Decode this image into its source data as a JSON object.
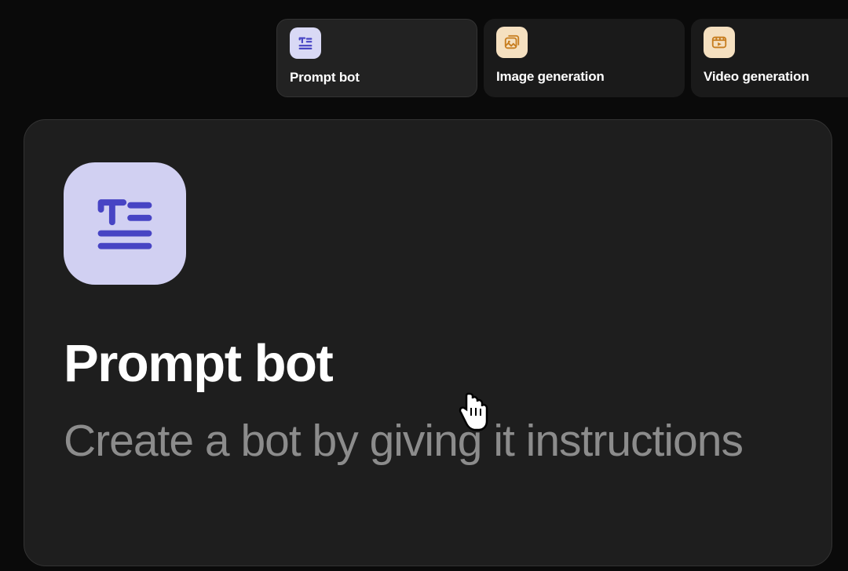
{
  "tabs": [
    {
      "label": "Prompt bot",
      "icon": "text-lines-icon",
      "iconTheme": "purple"
    },
    {
      "label": "Image generation",
      "icon": "image-stack-icon",
      "iconTheme": "orange"
    },
    {
      "label": "Video generation",
      "icon": "video-icon",
      "iconTheme": "orange"
    }
  ],
  "card": {
    "title": "Prompt bot",
    "description": "Create a bot by giving it instructions",
    "icon": "text-lines-icon",
    "iconTheme": "purple"
  },
  "colors": {
    "purpleBg": "#d1d0f2",
    "purpleFg": "#4744c4",
    "orangeBg": "#f5e0c0",
    "orangeFg": "#c77d1e"
  }
}
